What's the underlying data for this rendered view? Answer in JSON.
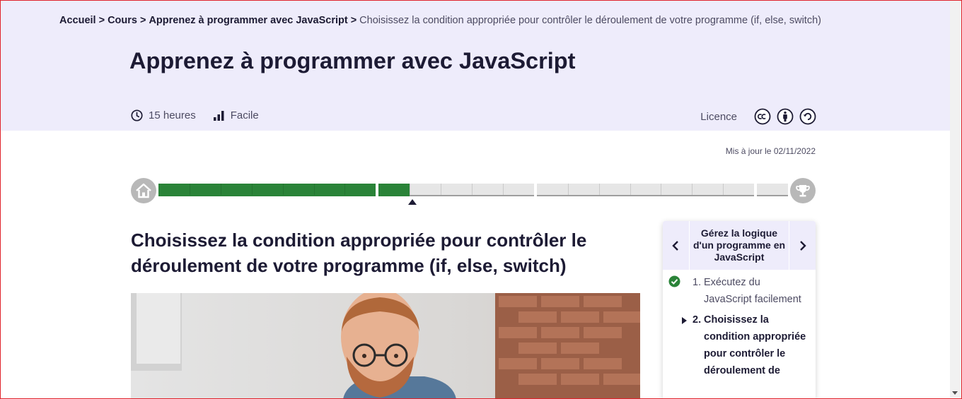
{
  "breadcrumb": {
    "items": [
      "Accueil",
      "Cours",
      "Apprenez à programmer avec JavaScript"
    ],
    "separator": ">",
    "current": "Choisissez la condition appropriée pour contrôler le déroulement de votre programme (if, else, switch)"
  },
  "course": {
    "title": "Apprenez à programmer avec JavaScript",
    "duration": "15 heures",
    "difficulty": "Facile",
    "licence_label": "Licence",
    "licence_icons": [
      "creative-commons-icon",
      "attribution-icon",
      "share-alike-icon"
    ],
    "updated": "Mis à jour le 02/11/2022"
  },
  "progress": {
    "parts": [
      {
        "steps": 7,
        "completed": 7
      },
      {
        "steps": 5,
        "completed": 1
      },
      {
        "steps": 7,
        "completed": 0
      },
      {
        "steps": 1,
        "completed": 0
      }
    ],
    "start_icon": "home-icon",
    "end_icon": "trophy-icon"
  },
  "chapter": {
    "title": "Choisissez la condition appropriée pour contrôler le déroulement de votre programme (if, else, switch)"
  },
  "sidebar": {
    "part_title": "Gérez la logique d'un programme en JavaScript",
    "items": [
      {
        "num": "1.",
        "label": "Exécutez du JavaScript facilement",
        "status": "completed"
      },
      {
        "num": "2.",
        "label": "Choisissez la condition appropriée pour contrôler le déroulement de",
        "status": "current"
      }
    ]
  },
  "colors": {
    "hero_bg": "#eeecfb",
    "text": "#1d1b34",
    "progress_done": "#2a8338",
    "progress_todo": "#e6e6e6",
    "frame": "#e0242c"
  }
}
